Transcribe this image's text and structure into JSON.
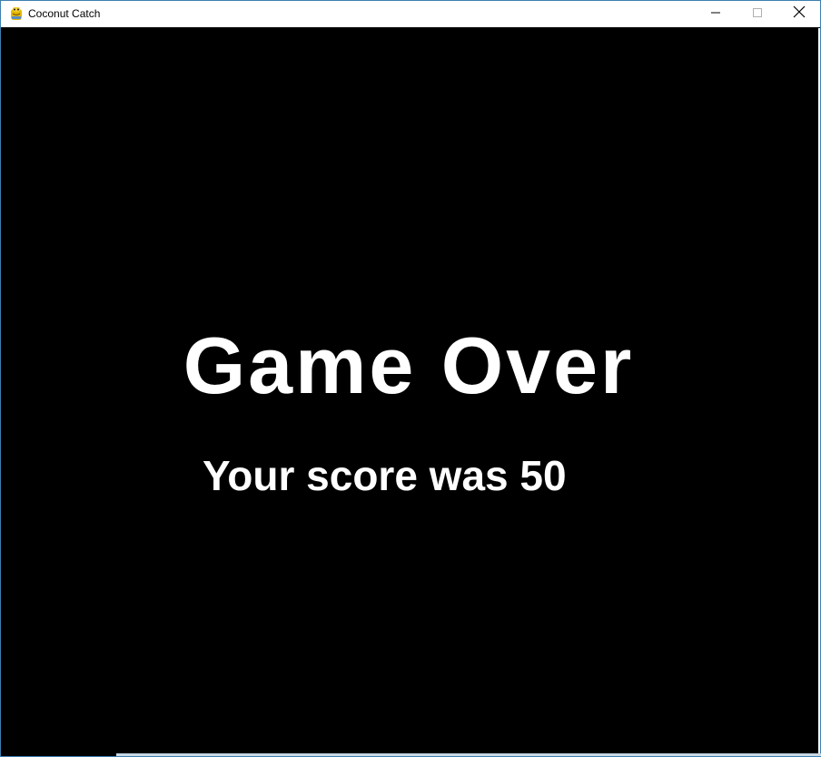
{
  "window": {
    "title": "Coconut Catch",
    "icon": "pygame-snake-icon",
    "controls": {
      "minimize": "minimize-icon",
      "maximize": "maximize-icon",
      "close": "close-icon"
    }
  },
  "game": {
    "heading": "Game Over",
    "score_text": "Your score was 50",
    "background_color": "#000000",
    "text_color": "#ffffff"
  }
}
